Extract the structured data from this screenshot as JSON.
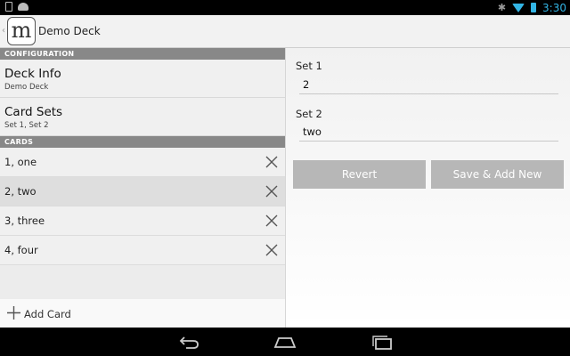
{
  "status_bar": {
    "time": "3:30"
  },
  "app_bar": {
    "icon_letter": "m",
    "title": "Demo Deck"
  },
  "configuration": {
    "header": "CONFIGURATION",
    "items": [
      {
        "title": "Deck Info",
        "subtitle": "Demo Deck"
      },
      {
        "title": "Card Sets",
        "subtitle": "Set 1, Set 2"
      }
    ]
  },
  "cards": {
    "header": "CARDS",
    "items": [
      {
        "label": "1, one",
        "selected": false
      },
      {
        "label": "2, two",
        "selected": true
      },
      {
        "label": "3, three",
        "selected": false
      },
      {
        "label": "4, four",
        "selected": false
      }
    ]
  },
  "add_card": {
    "label": "Add Card"
  },
  "editor": {
    "fields": [
      {
        "label": "Set 1",
        "value": "2"
      },
      {
        "label": "Set 2",
        "value": "two"
      }
    ],
    "revert_label": "Revert",
    "save_label": "Save & Add New"
  },
  "colors": {
    "accent": "#33b5e5",
    "section_header_bg": "#888888",
    "button_bg": "#b7b7b7",
    "selected_row_bg": "#dedede"
  },
  "icons": [
    "bluetooth-icon",
    "wifi-icon",
    "battery-icon",
    "delete-icon",
    "add-icon",
    "back-icon",
    "home-icon",
    "recent-apps-icon"
  ]
}
